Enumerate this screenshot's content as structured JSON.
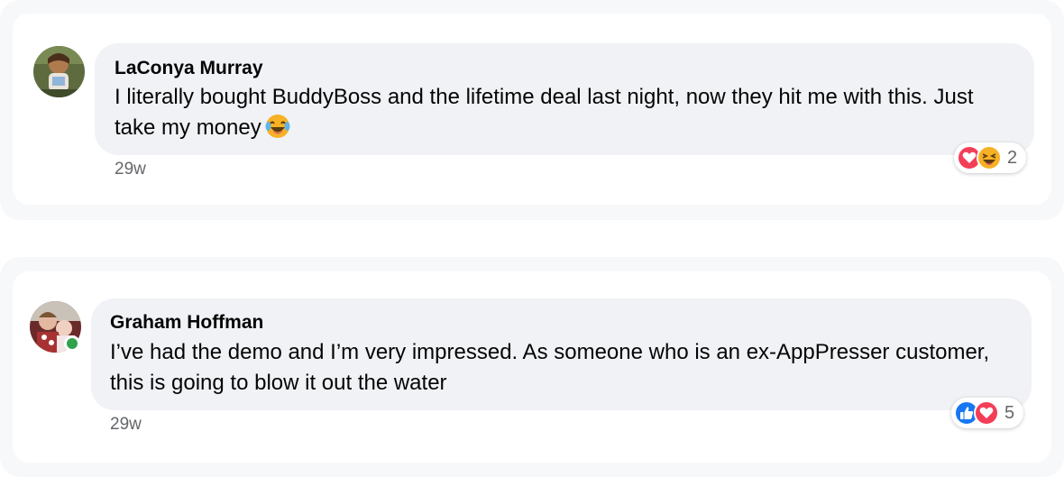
{
  "comments": [
    {
      "author": "LaConya Murray",
      "text": "I literally bought BuddyBoss and the lifetime deal last night, now they hit me with this. Just take my money",
      "inline_emoji": "tears-of-joy-emoji",
      "timestamp": "29w",
      "avatar": "user-avatar-photo",
      "online": false,
      "reactions": {
        "icons": [
          "love-reaction-icon",
          "haha-reaction-icon"
        ],
        "count": "2"
      }
    },
    {
      "author": "Graham Hoffman",
      "text": "I’ve had the demo and I’m very impressed. As someone who is an ex-AppPresser customer, this is going to blow it out the water",
      "timestamp": "29w",
      "avatar": "user-avatar-photo",
      "online": true,
      "reactions": {
        "icons": [
          "like-reaction-icon",
          "love-reaction-icon"
        ],
        "count": "5"
      }
    }
  ],
  "colors": {
    "bubble": "#f0f2f5",
    "like": "#1877f2",
    "love": "#f33e58",
    "haha": "#f7b125",
    "online": "#31a24c",
    "secondary_text": "#65676b"
  }
}
